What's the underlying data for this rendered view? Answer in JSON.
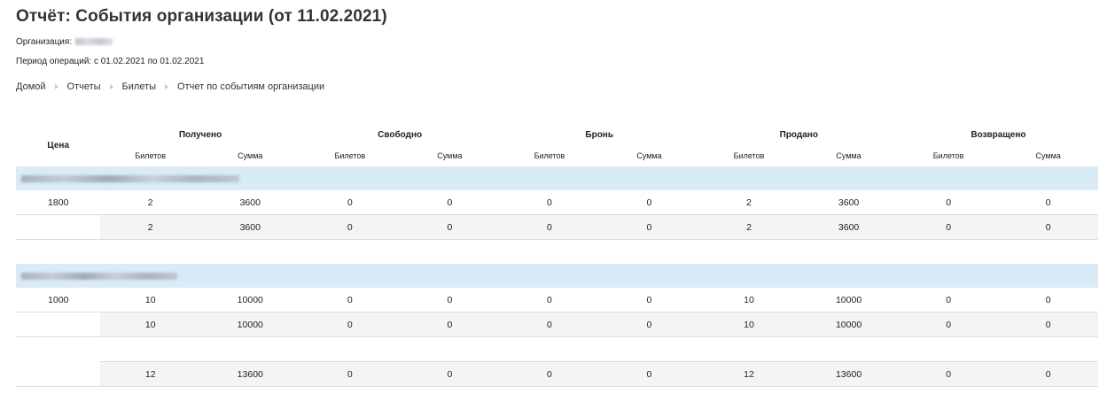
{
  "page": {
    "title": "Отчёт: События организации (от 11.02.2021)",
    "org_label": "Организация:",
    "period": "Период операций: с 01.02.2021 по 01.02.2021"
  },
  "breadcrumb": [
    "Домой",
    "Отчеты",
    "Билеты",
    "Отчет по событиям организации"
  ],
  "table": {
    "price_header": "Цена",
    "groups": [
      "Получено",
      "Свободно",
      "Бронь",
      "Продано",
      "Возвращено"
    ],
    "sub": [
      "Билетов",
      "Сумма"
    ],
    "sections": [
      {
        "row": [
          "1800",
          "2",
          "3600",
          "0",
          "0",
          "0",
          "0",
          "2",
          "3600",
          "0",
          "0"
        ],
        "subtotal": [
          "",
          "2",
          "3600",
          "0",
          "0",
          "0",
          "0",
          "2",
          "3600",
          "0",
          "0"
        ]
      },
      {
        "row": [
          "1000",
          "10",
          "10000",
          "0",
          "0",
          "0",
          "0",
          "10",
          "10000",
          "0",
          "0"
        ],
        "subtotal": [
          "",
          "10",
          "10000",
          "0",
          "0",
          "0",
          "0",
          "10",
          "10000",
          "0",
          "0"
        ]
      }
    ],
    "total": [
      "",
      "12",
      "13600",
      "0",
      "0",
      "0",
      "0",
      "12",
      "13600",
      "0",
      "0"
    ]
  }
}
